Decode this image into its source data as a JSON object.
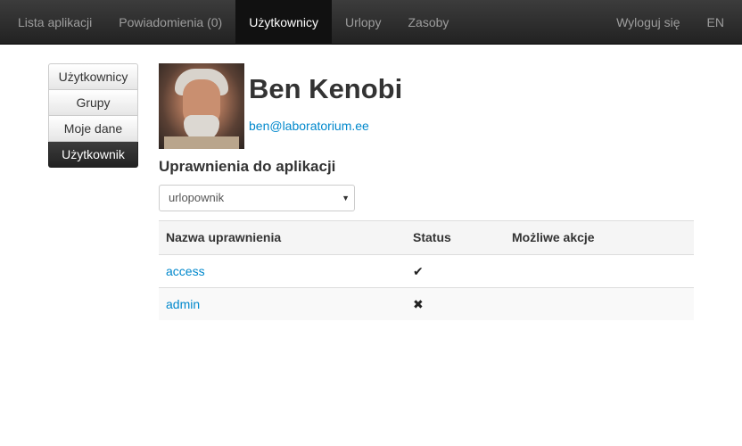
{
  "navbar": {
    "left_items": [
      {
        "label": "Lista aplikacji",
        "active": false
      },
      {
        "label": "Powiadomienia (0)",
        "active": false
      },
      {
        "label": "Użytkownicy",
        "active": true
      },
      {
        "label": "Urlopy",
        "active": false
      },
      {
        "label": "Zasoby",
        "active": false
      }
    ],
    "logout_label": "Wyloguj się",
    "language_label": "EN"
  },
  "sidebar": {
    "items": [
      {
        "label": "Użytkownicy",
        "active": false
      },
      {
        "label": "Grupy",
        "active": false
      },
      {
        "label": "Moje dane",
        "active": false
      },
      {
        "label": "Użytkownik",
        "active": true
      }
    ]
  },
  "profile": {
    "name": "Ben Kenobi",
    "email": "ben@laboratorium.ee",
    "avatar_icon": "user-photo"
  },
  "permissions": {
    "title": "Uprawnienia do aplikacji",
    "selected_application": "urlopownik",
    "columns": [
      "Nazwa uprawnienia",
      "Status",
      "Możliwe akcje"
    ],
    "rows": [
      {
        "name": "access",
        "status_glyph": "✔",
        "status_icon": "check-icon",
        "actions": ""
      },
      {
        "name": "admin",
        "status_glyph": "✖",
        "status_icon": "cross-icon",
        "actions": ""
      }
    ]
  },
  "colors": {
    "navbar_bg": "#222222",
    "link": "#0088cc",
    "active_nav_text": "#ffffff",
    "inactive_nav_text": "#9d9d9d"
  }
}
